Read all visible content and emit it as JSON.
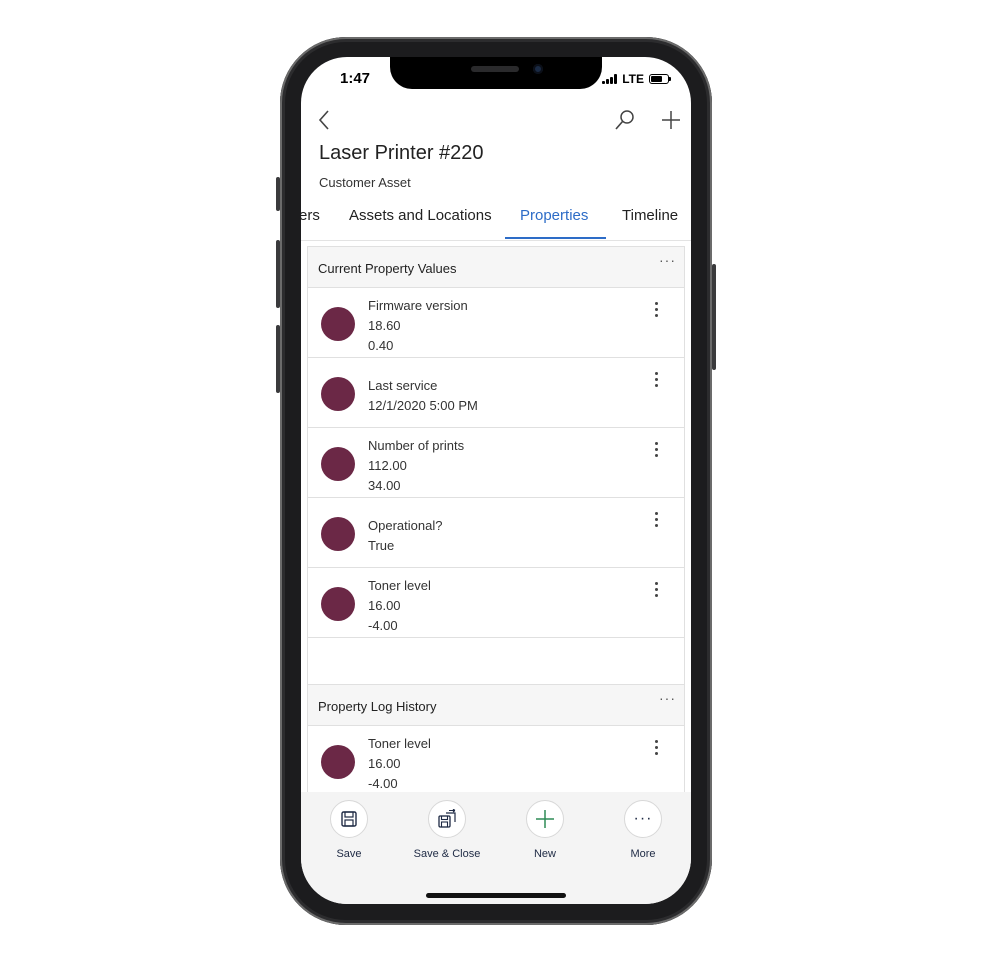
{
  "status_bar": {
    "time": "1:47",
    "network": "LTE"
  },
  "header": {
    "title": "Laser Printer #220",
    "subtitle": "Customer Asset"
  },
  "tabs": [
    {
      "label": "ers"
    },
    {
      "label": "Assets and Locations"
    },
    {
      "label": "Properties"
    },
    {
      "label": "Timeline"
    }
  ],
  "active_tab": "Properties",
  "current_values": {
    "title": "Current Property Values",
    "more": "···",
    "rows": [
      {
        "name": "Firmware version",
        "line1": "18.60",
        "line2": "0.40"
      },
      {
        "name": "Last service",
        "line1": "12/1/2020 5:00 PM",
        "line2": ""
      },
      {
        "name": "Number of prints",
        "line1": "112.00",
        "line2": "34.00"
      },
      {
        "name": "Operational?",
        "line1": "True",
        "line2": ""
      },
      {
        "name": "Toner level",
        "line1": "16.00",
        "line2": "-4.00"
      }
    ]
  },
  "log_history": {
    "title": "Property Log History",
    "more": "···",
    "rows": [
      {
        "name": "Toner level",
        "line1": "16.00",
        "line2": "-4.00"
      }
    ]
  },
  "command_bar": {
    "save": "Save",
    "save_close": "Save & Close",
    "new": "New",
    "more": "More",
    "more_glyph": "···"
  },
  "colors": {
    "accent": "#2d6cc7",
    "avatar": "#6b2846",
    "new_icon": "#2e8b57"
  },
  "icons": [
    "back-chevron-icon",
    "search-icon",
    "add-icon",
    "save-icon",
    "save-close-icon",
    "plus-icon",
    "more-icon"
  ]
}
